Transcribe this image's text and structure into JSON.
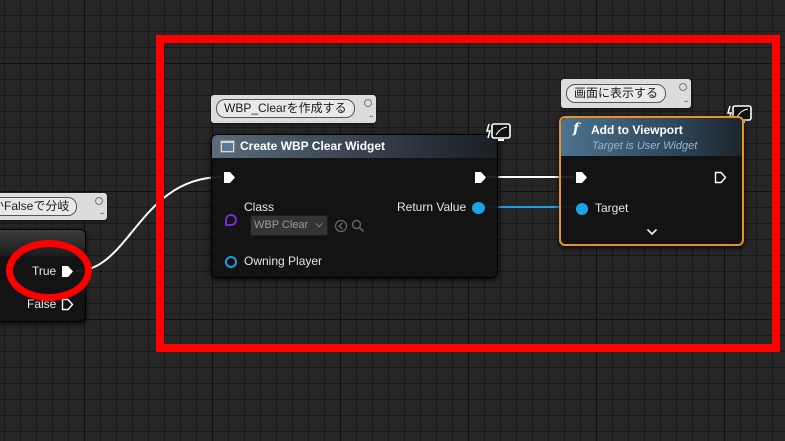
{
  "comments": {
    "branch_comment": "かFalseで分岐",
    "create_comment": "WBP_Clearを作成する",
    "viewport_comment": "画面に表示する"
  },
  "branch_node": {
    "true_label": "True",
    "false_label": "False"
  },
  "create_widget_node": {
    "title": "Create WBP Clear Widget",
    "class_label": "Class",
    "class_value": "WBP Clear",
    "owning_player_label": "Owning Player",
    "return_value_label": "Return Value",
    "header_color": "#4a5a6a"
  },
  "add_to_viewport_node": {
    "title": "Add to Viewport",
    "subtitle": "Target is User Widget",
    "target_label": "Target",
    "header_color": "#3f5f78",
    "selection_color": "#e8922a"
  },
  "colors": {
    "highlight_red": "#ff0000",
    "object_pin": "#1ea0e6",
    "class_pin": "#7a2ad6",
    "exec_wire": "#ffffff"
  },
  "icons": {
    "function": "function-icon",
    "widget": "widget-icon",
    "client_server": "monitor-icon"
  }
}
